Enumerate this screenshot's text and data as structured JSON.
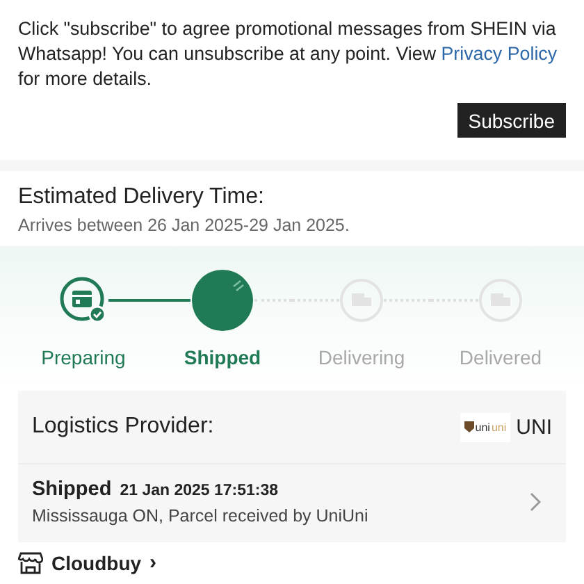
{
  "notice": {
    "text_before": "Click \"subscribe\" to agree promotional messages from SHEIN via Whatsapp! You can unsubscribe at any point. View",
    "link": "Privacy Policy",
    "text_after": "for more details.",
    "button": "Subscribe"
  },
  "delivery": {
    "title": "Estimated Delivery Time:",
    "range": "Arrives between 26 Jan 2025-29 Jan 2025."
  },
  "steps": [
    {
      "label": "Preparing",
      "completed": true,
      "current": false
    },
    {
      "label": "Shipped",
      "completed": false,
      "current": true
    },
    {
      "label": "Delivering",
      "completed": false,
      "current": false
    },
    {
      "label": "Delivered",
      "completed": false,
      "current": false
    }
  ],
  "logistics": {
    "label": "Logistics Provider:",
    "logo": "uniuni",
    "provider": "UNI",
    "event_status": "Shipped",
    "event_time": "21 Jan 2025 17:51:38",
    "event_detail": "Mississauga ON, Parcel received by UniUni"
  },
  "store": {
    "name": "Cloudbuy",
    "arrow": "›"
  }
}
